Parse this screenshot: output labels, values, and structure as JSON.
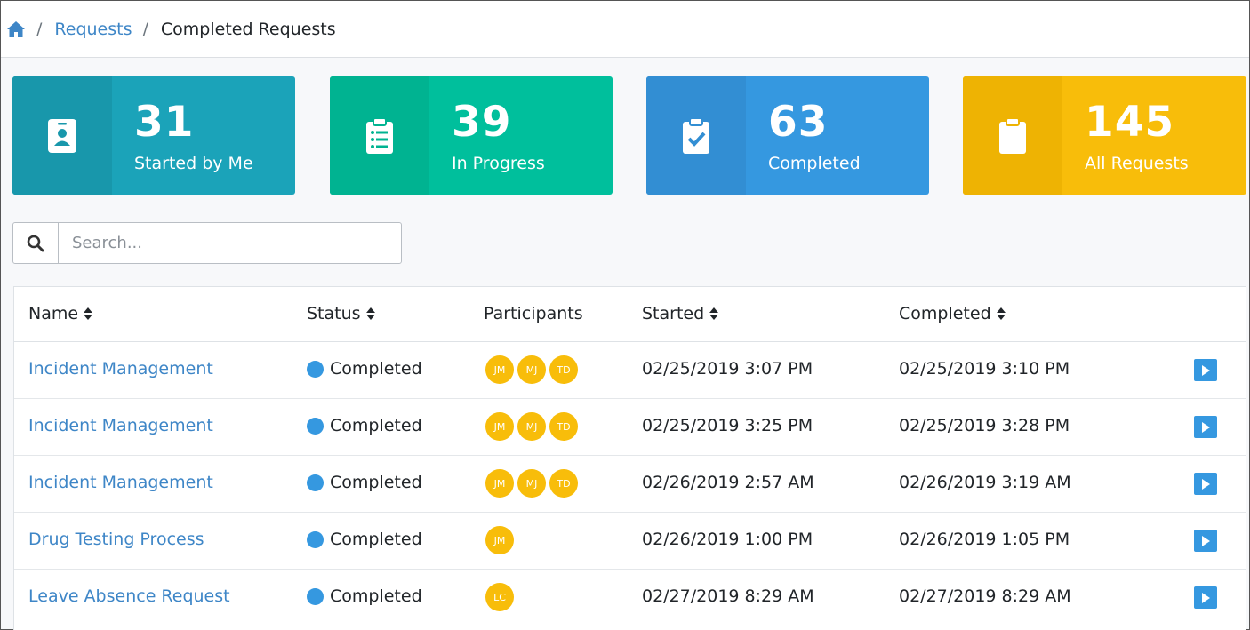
{
  "breadcrumb": {
    "home_icon": "home-icon",
    "items": [
      "Requests",
      "Completed Requests"
    ],
    "separator": "/"
  },
  "cards": [
    {
      "count": "31",
      "label": "Started by Me",
      "icon": "id-badge-icon",
      "color": "#1ba3b9"
    },
    {
      "count": "39",
      "label": "In Progress",
      "icon": "clipboard-list-icon",
      "color": "#00bf9c"
    },
    {
      "count": "63",
      "label": "Completed",
      "icon": "clipboard-check-icon",
      "color": "#3598e0"
    },
    {
      "count": "145",
      "label": "All Requests",
      "icon": "clipboard-icon",
      "color": "#f8bd0a"
    }
  ],
  "search": {
    "placeholder": "Search...",
    "icon": "search-icon"
  },
  "table": {
    "headers": [
      "Name",
      "Status",
      "Participants",
      "Started",
      "Completed"
    ],
    "rows": [
      {
        "name": "Incident Management",
        "status": "Completed",
        "participants": [
          "JM",
          "MJ",
          "TD"
        ],
        "started": "02/25/2019 3:07 PM",
        "completed": "02/25/2019 3:10 PM"
      },
      {
        "name": "Incident Management",
        "status": "Completed",
        "participants": [
          "JM",
          "MJ",
          "TD"
        ],
        "started": "02/25/2019 3:25 PM",
        "completed": "02/25/2019 3:28 PM"
      },
      {
        "name": "Incident Management",
        "status": "Completed",
        "participants": [
          "JM",
          "MJ",
          "TD"
        ],
        "started": "02/26/2019 2:57 AM",
        "completed": "02/26/2019 3:19 AM"
      },
      {
        "name": "Drug Testing Process",
        "status": "Completed",
        "participants": [
          "JM"
        ],
        "started": "02/26/2019 1:00 PM",
        "completed": "02/26/2019 1:05 PM"
      },
      {
        "name": "Leave Absence Request",
        "status": "Completed",
        "participants": [
          "LC"
        ],
        "started": "02/27/2019 8:29 AM",
        "completed": "02/27/2019 8:29 AM"
      }
    ]
  },
  "colors": {
    "link": "#3e86c7",
    "status_dot": "#3598e0",
    "avatar": "#f8bd0a"
  }
}
